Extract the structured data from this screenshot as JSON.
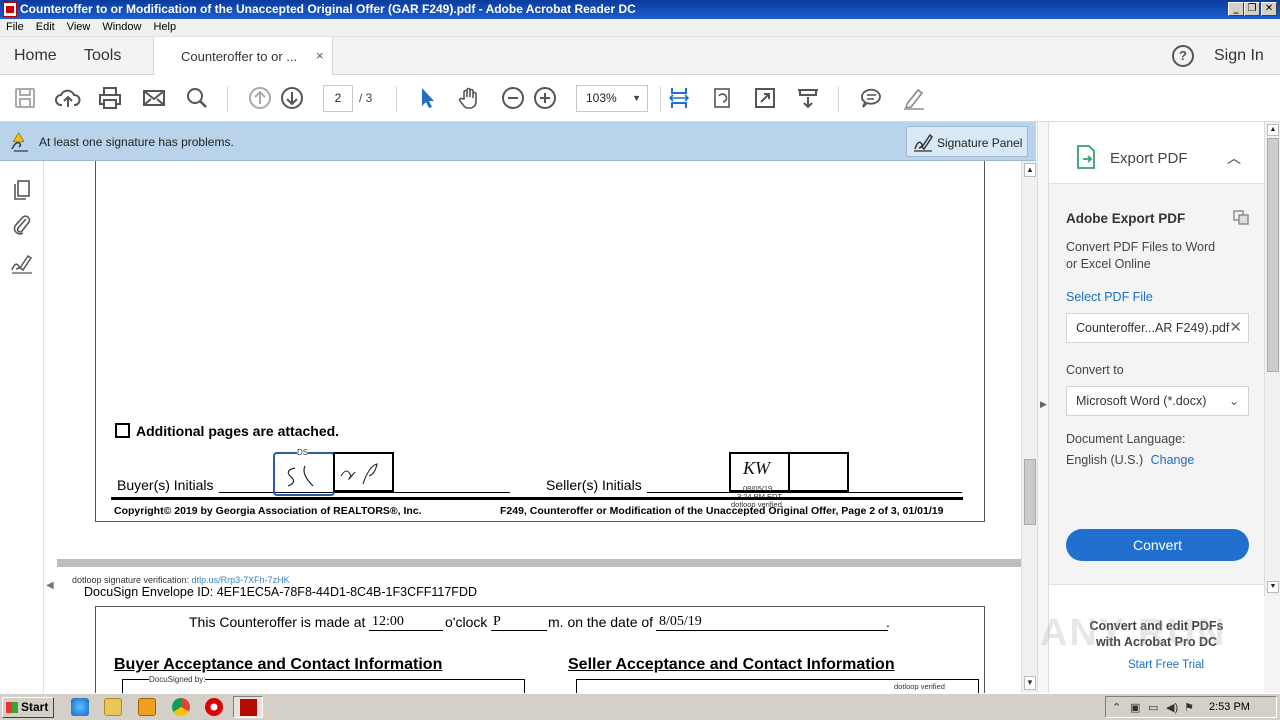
{
  "window": {
    "title": "Counteroffer to or Modification of the Unaccepted Original Offer (GAR F249).pdf - Adobe Acrobat Reader DC",
    "minimize": "_",
    "restore": "❐",
    "close": "✕"
  },
  "menu": [
    "File",
    "Edit",
    "View",
    "Window",
    "Help"
  ],
  "tabs": {
    "home": "Home",
    "tools": "Tools",
    "document": "Counteroffer to or ...",
    "close": "×",
    "help": "?",
    "sign_in": "Sign In"
  },
  "toolbar": {
    "current_page": "2",
    "total_pages": "/ 3",
    "zoom": "103%",
    "zoom_dropdown": "▼",
    "icons": [
      "save-icon",
      "upload-cloud-icon",
      "print-icon",
      "email-icon",
      "search-icon",
      "page-up-icon",
      "page-down-icon",
      "select-cursor-icon",
      "hand-icon",
      "zoom-out-icon",
      "zoom-in-icon",
      "fit-width-icon",
      "rotate-icon",
      "full-screen-icon",
      "read-mode-icon",
      "comment-icon",
      "highlight-pen-icon"
    ]
  },
  "signature_bar": {
    "message": "At least one signature has problems.",
    "panel_button": "Signature Panel"
  },
  "document": {
    "page2": {
      "checkbox_label": "Additional pages are attached.",
      "buyer_initials_label": "Buyer(s) Initials",
      "seller_initials_label": "Seller(s) Initials",
      "ds_mark": "DS",
      "seller_initial": "KW",
      "dotloop_date": "08/05/19",
      "dotloop_time": "3:24 PM EDT",
      "dotloop_verified": "dotloop verified",
      "copyright": "Copyright© 2019 by Georgia Association of REALTORS®, Inc.",
      "footer_right": "F249, Counteroffer or Modification of the Unaccepted Original Offer, Page 2 of 3, 01/01/19"
    },
    "page3": {
      "verification_prefix": "dotloop signature verification: ",
      "verification_link": "dtlp.us/Rrp3-7XFh-7zHK",
      "envelope_id": "DocuSign Envelope ID: 4EF1EC5A-78F8-44D1-8C4B-1F3CFF117FDD",
      "made_at_label": "This Counteroffer is made at",
      "time_value": "12:00",
      "oclock_label": "o'clock",
      "ampm_value": "P",
      "date_label": "m. on the date of",
      "date_value": "8/05/19",
      "period": ".",
      "buyer_section": "Buyer Acceptance and Contact Information",
      "seller_section": "Seller Acceptance and Contact Information",
      "docusigned_by": "DocuSigned by:",
      "dotloop_verified": "dotloop verified"
    }
  },
  "right_panel": {
    "header": "Export PDF",
    "title": "Adobe Export PDF",
    "description_line1": "Convert PDF Files to Word",
    "description_line2": "or Excel Online",
    "select_label": "Select PDF File",
    "selected_file": "Counteroffer...AR F249).pdf",
    "convert_to_label": "Convert to",
    "convert_to_value": "Microsoft Word (*.docx)",
    "language_label": "Document Language:",
    "language_value": "English (U.S.)",
    "change_link": "Change",
    "convert_button": "Convert",
    "promo_line1": "Convert and edit PDFs",
    "promo_line2": "with Acrobat Pro DC",
    "trial_link": "Start Free Trial"
  },
  "taskbar": {
    "start": "Start",
    "clock": "2:53 PM",
    "apps": [
      "ie-icon",
      "folder-icon",
      "media-player-icon",
      "chrome-icon",
      "opera-icon",
      "acrobat-icon"
    ]
  },
  "watermark": "ANY RUN"
}
